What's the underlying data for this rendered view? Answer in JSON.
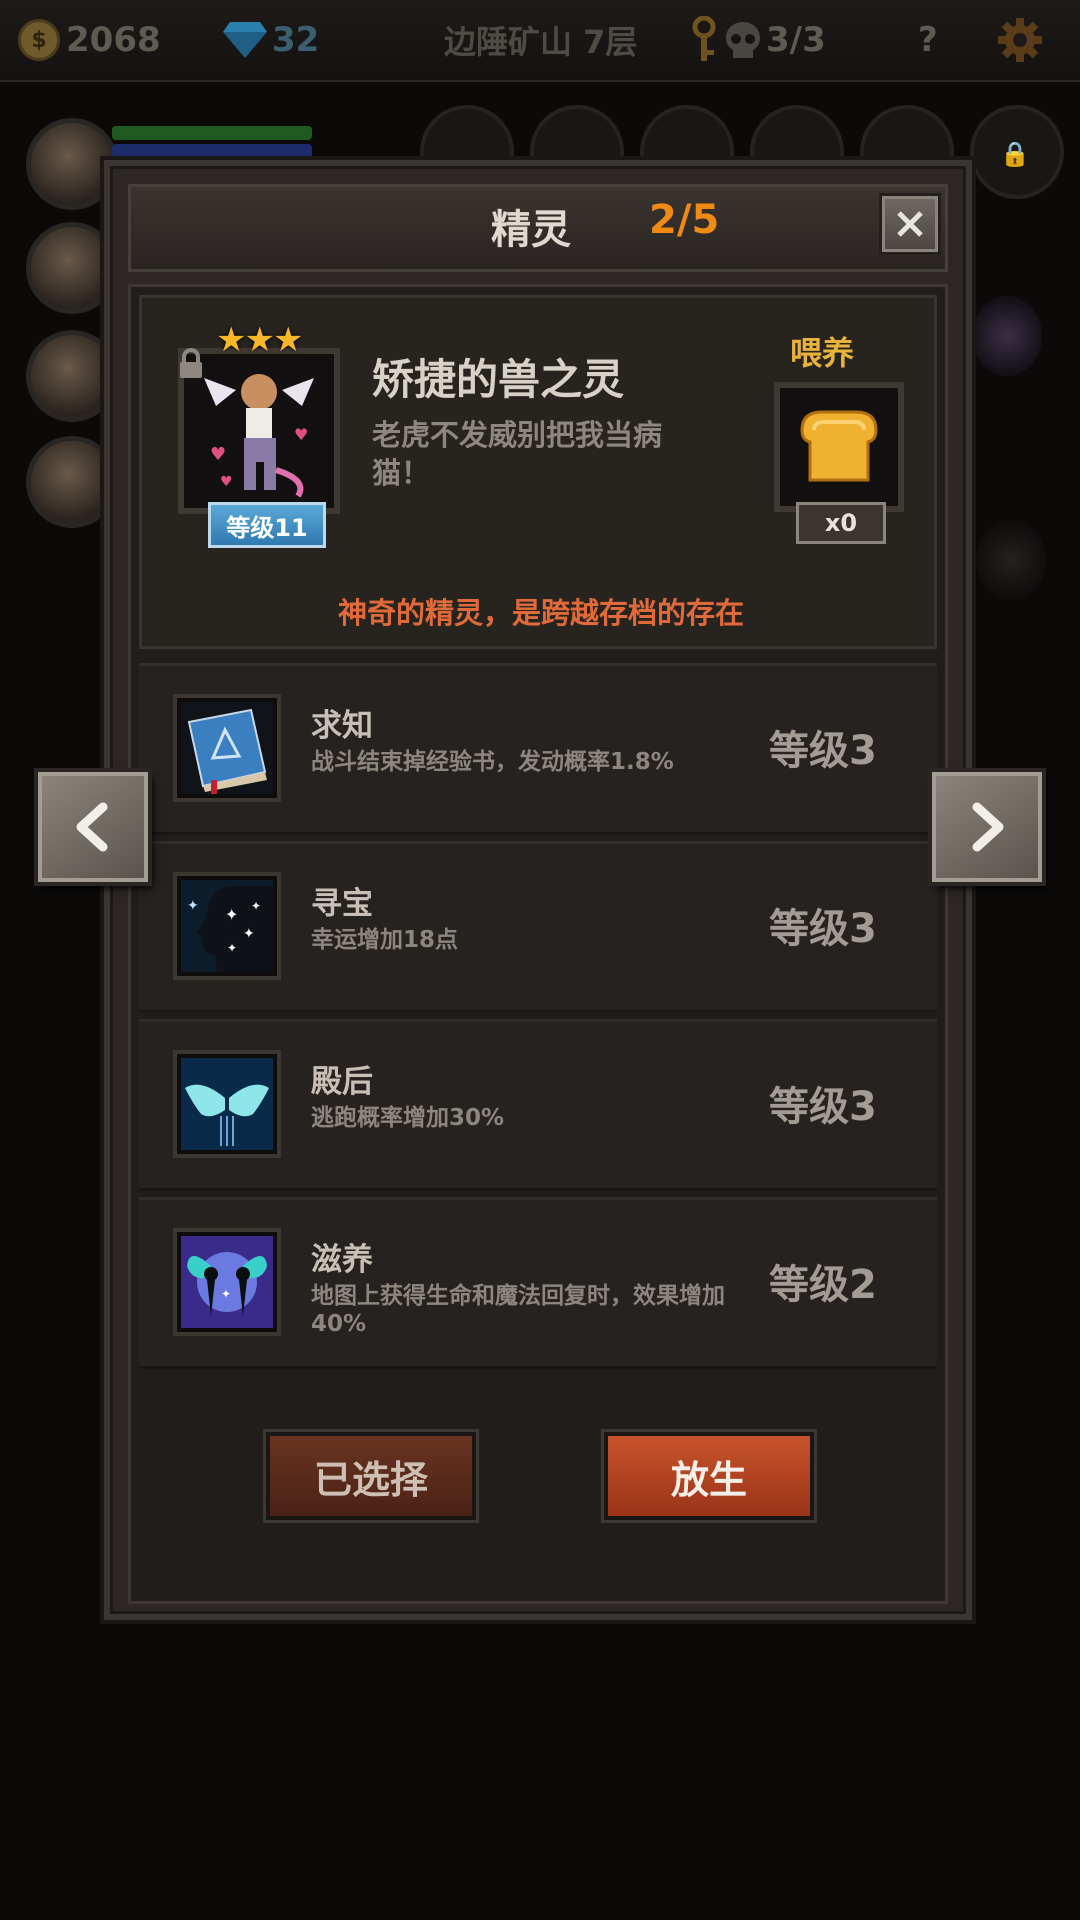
{
  "topbar": {
    "gold": "2068",
    "gems": "32",
    "location": "边陲矿山 7层",
    "skulls": "3/3",
    "help": "?"
  },
  "dialog": {
    "title": "精灵",
    "count": "2/5"
  },
  "spirit": {
    "name": "矫捷的兽之灵",
    "description": "老虎不发威别把我当病猫！",
    "stars": "★★★",
    "level": "等级11",
    "feed_label": "喂养",
    "feed_count": "x0",
    "note": "神奇的精灵，是跨越存档的存在"
  },
  "skills": [
    {
      "name": "求知",
      "description": "战斗结束掉经验书，发动概率1.8%",
      "level": "等级3",
      "icon": "book-icon"
    },
    {
      "name": "寻宝",
      "description": "幸运增加18点",
      "level": "等级3",
      "icon": "sparkle-silhouette-icon"
    },
    {
      "name": "殿后",
      "description": "逃跑概率增加30%",
      "level": "等级3",
      "icon": "wings-icon"
    },
    {
      "name": "滋养",
      "description": "地图上获得生命和魔法回复时，效果增加40%",
      "level": "等级2",
      "icon": "fairies-icon"
    }
  ],
  "buttons": {
    "selected": "已选择",
    "release": "放生"
  },
  "colors": {
    "accent_orange": "#f08a16",
    "feed_gold": "#e8b33c",
    "note_orange": "#e06a3a",
    "level_badge_blue": "#2f7ab0",
    "release_red": "#b8441f"
  }
}
